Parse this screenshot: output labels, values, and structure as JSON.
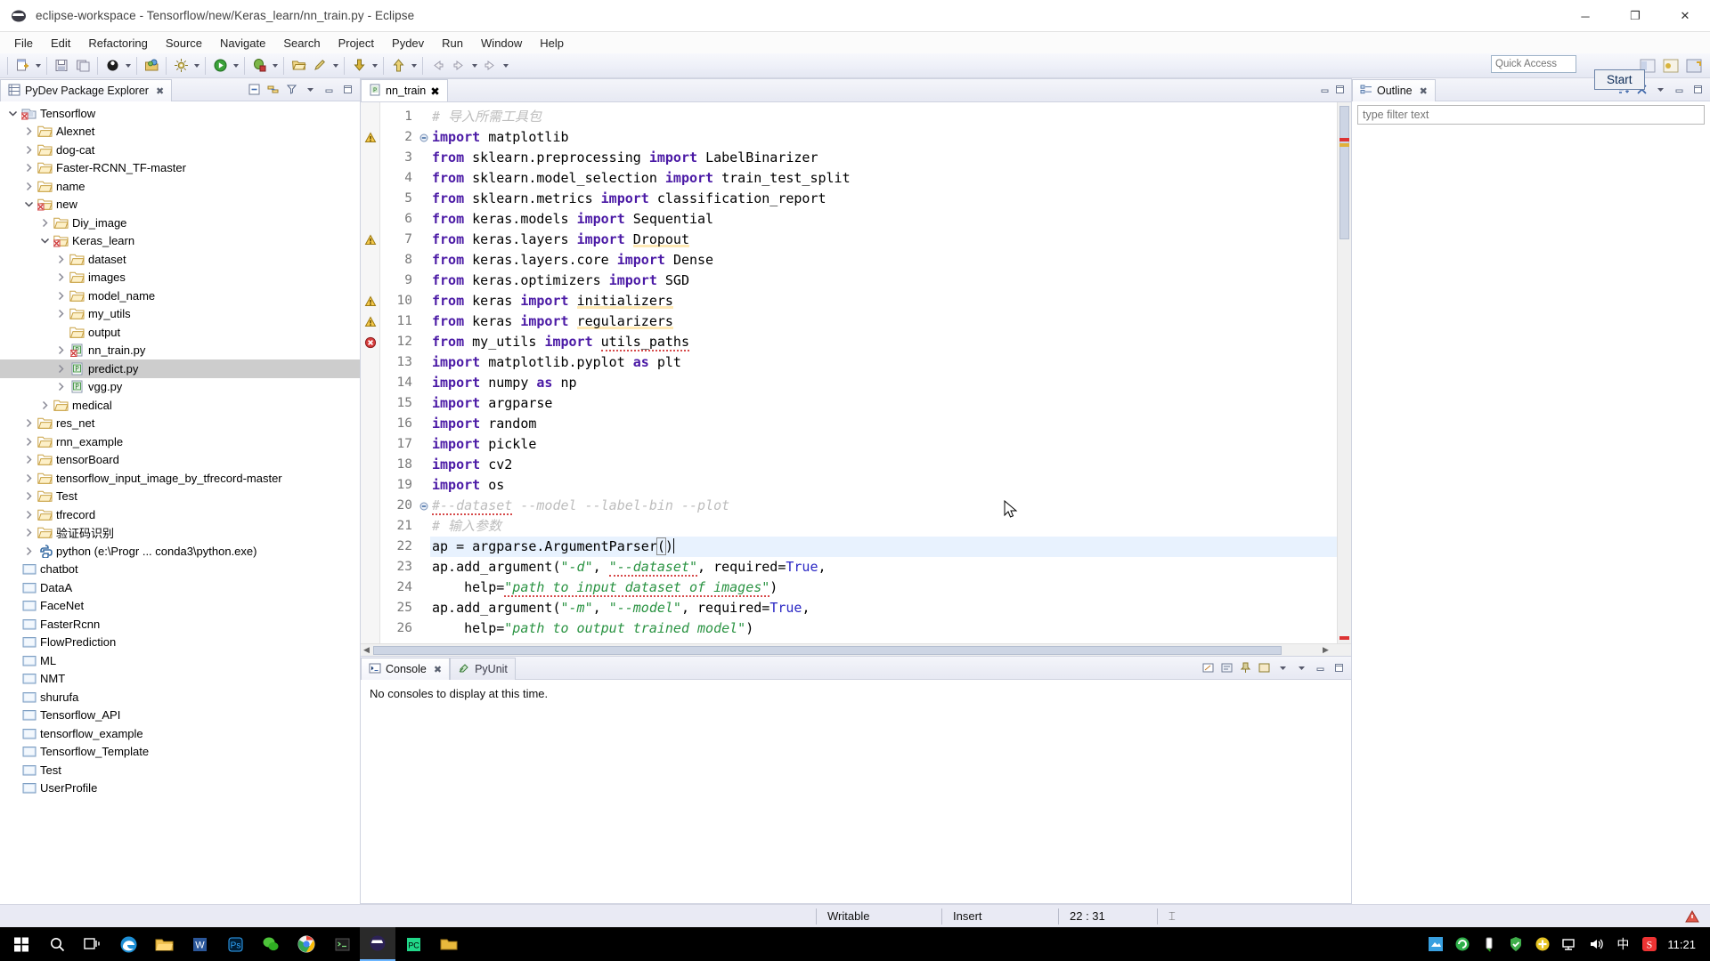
{
  "window": {
    "title": "eclipse-workspace - Tensorflow/new/Keras_learn/nn_train.py - Eclipse",
    "minimize": "─",
    "maximize": "❐",
    "close": "✕"
  },
  "menubar": {
    "items": [
      "File",
      "Edit",
      "Refactoring",
      "Source",
      "Navigate",
      "Search",
      "Project",
      "Pydev",
      "Run",
      "Window",
      "Help"
    ]
  },
  "toolbar": {
    "quick_access_placeholder": "Quick Access",
    "icons": [
      "new-file-icon",
      "save-icon",
      "save-all-icon",
      "debug-perspective-icon",
      "open-type-icon",
      "build-icon",
      "run-icon",
      "debug-icon",
      "open-folder-icon",
      "pencil-icon",
      "download-icon",
      "upload-icon",
      "back-icon",
      "forward-icon",
      "next-annotation-icon"
    ],
    "perspective_icons": [
      "pydev-perspective-icon",
      "java-perspective-icon",
      "open-perspective-icon"
    ]
  },
  "explorer": {
    "tab_title": "PyDev Package Explorer",
    "tab_close": "✖",
    "tools": [
      "collapse-all-icon",
      "link-with-editor-icon",
      "view-filter-icon",
      "view-menu-icon",
      "minimize-icon",
      "maximize-icon"
    ],
    "tree": [
      {
        "label": "Tensorflow",
        "depth": 0,
        "icon": "project-python-icon",
        "twist": "open",
        "selected": false
      },
      {
        "label": "Alexnet",
        "depth": 1,
        "icon": "folder-icon",
        "twist": "closed",
        "selected": false
      },
      {
        "label": "dog-cat",
        "depth": 1,
        "icon": "folder-icon",
        "twist": "closed",
        "selected": false
      },
      {
        "label": "Faster-RCNN_TF-master",
        "depth": 1,
        "icon": "folder-icon",
        "twist": "closed",
        "selected": false
      },
      {
        "label": "name",
        "depth": 1,
        "icon": "folder-icon",
        "twist": "closed",
        "selected": false
      },
      {
        "label": "new",
        "depth": 1,
        "icon": "folder-error-icon",
        "twist": "open",
        "selected": false
      },
      {
        "label": "Diy_image",
        "depth": 2,
        "icon": "folder-icon",
        "twist": "closed",
        "selected": false
      },
      {
        "label": "Keras_learn",
        "depth": 2,
        "icon": "folder-error-icon",
        "twist": "open",
        "selected": false
      },
      {
        "label": "dataset",
        "depth": 3,
        "icon": "folder-icon",
        "twist": "closed",
        "selected": false
      },
      {
        "label": "images",
        "depth": 3,
        "icon": "folder-icon",
        "twist": "closed",
        "selected": false
      },
      {
        "label": "model_name",
        "depth": 3,
        "icon": "folder-icon",
        "twist": "closed",
        "selected": false
      },
      {
        "label": "my_utils",
        "depth": 3,
        "icon": "folder-icon",
        "twist": "closed",
        "selected": false
      },
      {
        "label": "output",
        "depth": 3,
        "icon": "folder-icon",
        "twist": "none",
        "selected": false
      },
      {
        "label": "nn_train.py",
        "depth": 3,
        "icon": "python-error-file-icon",
        "twist": "closed",
        "selected": false
      },
      {
        "label": "predict.py",
        "depth": 3,
        "icon": "python-file-icon",
        "twist": "closed",
        "selected": true
      },
      {
        "label": "vgg.py",
        "depth": 3,
        "icon": "python-file-icon",
        "twist": "closed",
        "selected": false
      },
      {
        "label": "medical",
        "depth": 2,
        "icon": "folder-icon",
        "twist": "closed",
        "selected": false
      },
      {
        "label": "res_net",
        "depth": 1,
        "icon": "folder-icon",
        "twist": "closed",
        "selected": false
      },
      {
        "label": "rnn_example",
        "depth": 1,
        "icon": "folder-icon",
        "twist": "closed",
        "selected": false
      },
      {
        "label": "tensorBoard",
        "depth": 1,
        "icon": "folder-icon",
        "twist": "closed",
        "selected": false
      },
      {
        "label": "tensorflow_input_image_by_tfrecord-master",
        "depth": 1,
        "icon": "folder-icon",
        "twist": "closed",
        "selected": false
      },
      {
        "label": "Test",
        "depth": 1,
        "icon": "folder-icon",
        "twist": "closed",
        "selected": false
      },
      {
        "label": "tfrecord",
        "depth": 1,
        "icon": "folder-icon",
        "twist": "closed",
        "selected": false
      },
      {
        "label": "验证码识别",
        "depth": 1,
        "icon": "folder-icon",
        "twist": "closed",
        "selected": false
      },
      {
        "label": "python  (e:\\Progr ... conda3\\python.exe)",
        "depth": 1,
        "icon": "python-interp-icon",
        "twist": "closed",
        "selected": false
      },
      {
        "label": "chatbot",
        "depth": 0,
        "icon": "closed-project-icon",
        "twist": "none",
        "selected": false
      },
      {
        "label": "DataA",
        "depth": 0,
        "icon": "closed-project-icon",
        "twist": "none",
        "selected": false
      },
      {
        "label": "FaceNet",
        "depth": 0,
        "icon": "closed-project-icon",
        "twist": "none",
        "selected": false
      },
      {
        "label": "FasterRcnn",
        "depth": 0,
        "icon": "closed-project-icon",
        "twist": "none",
        "selected": false
      },
      {
        "label": "FlowPrediction",
        "depth": 0,
        "icon": "closed-project-icon",
        "twist": "none",
        "selected": false
      },
      {
        "label": "ML",
        "depth": 0,
        "icon": "closed-project-icon",
        "twist": "none",
        "selected": false
      },
      {
        "label": "NMT",
        "depth": 0,
        "icon": "closed-project-icon",
        "twist": "none",
        "selected": false
      },
      {
        "label": "shurufa",
        "depth": 0,
        "icon": "closed-project-icon",
        "twist": "none",
        "selected": false
      },
      {
        "label": "Tensorflow_API",
        "depth": 0,
        "icon": "closed-project-icon",
        "twist": "none",
        "selected": false
      },
      {
        "label": "tensorflow_example",
        "depth": 0,
        "icon": "closed-project-icon",
        "twist": "none",
        "selected": false
      },
      {
        "label": "Tensorflow_Template",
        "depth": 0,
        "icon": "closed-project-icon",
        "twist": "none",
        "selected": false
      },
      {
        "label": "Test",
        "depth": 0,
        "icon": "closed-project-icon",
        "twist": "none",
        "selected": false
      },
      {
        "label": "UserProfile",
        "depth": 0,
        "icon": "closed-project-icon",
        "twist": "none",
        "selected": false
      }
    ]
  },
  "editor": {
    "tab_label": "nn_train",
    "tab_icon": "python-file-icon",
    "tab_close": "✖",
    "minimize": "─",
    "maximize": "❐",
    "current_line": 22,
    "lines": [
      {
        "n": 1,
        "ann": "",
        "fold": "",
        "tokens": [
          {
            "t": "# 导入所需工具包",
            "c": "cmt"
          }
        ]
      },
      {
        "n": 2,
        "ann": "warning",
        "fold": "minus",
        "tokens": [
          {
            "t": "import ",
            "c": "kw"
          },
          {
            "t": "matplotlib",
            "c": "plain"
          }
        ]
      },
      {
        "n": 3,
        "ann": "",
        "fold": "",
        "tokens": [
          {
            "t": "from ",
            "c": "kw"
          },
          {
            "t": "sklearn.preprocessing ",
            "c": "plain"
          },
          {
            "t": "import ",
            "c": "kw"
          },
          {
            "t": "LabelBinarizer",
            "c": "plain"
          }
        ]
      },
      {
        "n": 4,
        "ann": "",
        "fold": "",
        "tokens": [
          {
            "t": "from ",
            "c": "kw"
          },
          {
            "t": "sklearn.model_selection ",
            "c": "plain"
          },
          {
            "t": "import ",
            "c": "kw"
          },
          {
            "t": "train_test_split",
            "c": "plain"
          }
        ]
      },
      {
        "n": 5,
        "ann": "",
        "fold": "",
        "tokens": [
          {
            "t": "from ",
            "c": "kw"
          },
          {
            "t": "sklearn.metrics ",
            "c": "plain"
          },
          {
            "t": "import ",
            "c": "kw"
          },
          {
            "t": "classification_report",
            "c": "plain"
          }
        ]
      },
      {
        "n": 6,
        "ann": "",
        "fold": "",
        "tokens": [
          {
            "t": "from ",
            "c": "kw"
          },
          {
            "t": "keras.models ",
            "c": "plain"
          },
          {
            "t": "import ",
            "c": "kw"
          },
          {
            "t": "Sequential",
            "c": "plain"
          }
        ]
      },
      {
        "n": 7,
        "ann": "warning",
        "fold": "",
        "tokens": [
          {
            "t": "from ",
            "c": "kw"
          },
          {
            "t": "keras.layers ",
            "c": "plain"
          },
          {
            "t": "import ",
            "c": "kw"
          },
          {
            "t": "Dropout",
            "c": "plain sqy"
          }
        ]
      },
      {
        "n": 8,
        "ann": "",
        "fold": "",
        "tokens": [
          {
            "t": "from ",
            "c": "kw"
          },
          {
            "t": "keras.layers.core ",
            "c": "plain"
          },
          {
            "t": "import ",
            "c": "kw"
          },
          {
            "t": "Dense",
            "c": "plain"
          }
        ]
      },
      {
        "n": 9,
        "ann": "",
        "fold": "",
        "tokens": [
          {
            "t": "from ",
            "c": "kw"
          },
          {
            "t": "keras.optimizers ",
            "c": "plain"
          },
          {
            "t": "import ",
            "c": "kw"
          },
          {
            "t": "SGD",
            "c": "plain"
          }
        ]
      },
      {
        "n": 10,
        "ann": "warning",
        "fold": "",
        "tokens": [
          {
            "t": "from ",
            "c": "kw"
          },
          {
            "t": "keras ",
            "c": "plain"
          },
          {
            "t": "import ",
            "c": "kw"
          },
          {
            "t": "initializers",
            "c": "plain sqy"
          }
        ]
      },
      {
        "n": 11,
        "ann": "warning",
        "fold": "",
        "tokens": [
          {
            "t": "from ",
            "c": "kw"
          },
          {
            "t": "keras ",
            "c": "plain"
          },
          {
            "t": "import ",
            "c": "kw"
          },
          {
            "t": "regularizers",
            "c": "plain sqy"
          }
        ]
      },
      {
        "n": 12,
        "ann": "error",
        "fold": "",
        "tokens": [
          {
            "t": "from ",
            "c": "kw"
          },
          {
            "t": "my_utils ",
            "c": "plain"
          },
          {
            "t": "import ",
            "c": "kw"
          },
          {
            "t": "utils_paths",
            "c": "plain sq"
          }
        ]
      },
      {
        "n": 13,
        "ann": "",
        "fold": "",
        "tokens": [
          {
            "t": "import ",
            "c": "kw"
          },
          {
            "t": "matplotlib.pyplot ",
            "c": "plain"
          },
          {
            "t": "as ",
            "c": "kw"
          },
          {
            "t": "plt",
            "c": "plain"
          }
        ]
      },
      {
        "n": 14,
        "ann": "",
        "fold": "",
        "tokens": [
          {
            "t": "import ",
            "c": "kw"
          },
          {
            "t": "numpy ",
            "c": "plain"
          },
          {
            "t": "as ",
            "c": "kw"
          },
          {
            "t": "np",
            "c": "plain"
          }
        ]
      },
      {
        "n": 15,
        "ann": "",
        "fold": "",
        "tokens": [
          {
            "t": "import ",
            "c": "kw"
          },
          {
            "t": "argparse",
            "c": "plain"
          }
        ]
      },
      {
        "n": 16,
        "ann": "",
        "fold": "",
        "tokens": [
          {
            "t": "import ",
            "c": "kw"
          },
          {
            "t": "random",
            "c": "plain"
          }
        ]
      },
      {
        "n": 17,
        "ann": "",
        "fold": "",
        "tokens": [
          {
            "t": "import ",
            "c": "kw"
          },
          {
            "t": "pickle",
            "c": "plain"
          }
        ]
      },
      {
        "n": 18,
        "ann": "",
        "fold": "",
        "tokens": [
          {
            "t": "import ",
            "c": "kw"
          },
          {
            "t": "cv2",
            "c": "plain"
          }
        ]
      },
      {
        "n": 19,
        "ann": "",
        "fold": "",
        "tokens": [
          {
            "t": "import ",
            "c": "kw"
          },
          {
            "t": "os",
            "c": "plain"
          }
        ]
      },
      {
        "n": 20,
        "ann": "",
        "fold": "minus",
        "tokens": [
          {
            "t": "#--dataset",
            "c": "cmt sq"
          },
          {
            "t": " --model --label-bin --plot",
            "c": "cmt"
          }
        ]
      },
      {
        "n": 21,
        "ann": "",
        "fold": "",
        "tokens": [
          {
            "t": "# 输入参数",
            "c": "cmt"
          }
        ]
      },
      {
        "n": 22,
        "ann": "",
        "fold": "",
        "tokens": [
          {
            "t": "ap = argparse.ArgumentParser",
            "c": "plain"
          },
          {
            "t": "(",
            "c": "plain brkt"
          },
          {
            "t": ")",
            "c": "plain"
          }
        ]
      },
      {
        "n": 23,
        "ann": "",
        "fold": "",
        "tokens": [
          {
            "t": "ap.add_argument(",
            "c": "plain"
          },
          {
            "t": "\"-d\"",
            "c": "str"
          },
          {
            "t": ", ",
            "c": "plain"
          },
          {
            "t": "\"--dataset\"",
            "c": "str sq"
          },
          {
            "t": ", required=",
            "c": "plain"
          },
          {
            "t": "True",
            "c": "builtin"
          },
          {
            "t": ",",
            "c": "plain"
          }
        ]
      },
      {
        "n": 24,
        "ann": "",
        "fold": "",
        "tokens": [
          {
            "t": "    help=",
            "c": "plain"
          },
          {
            "t": "\"path to input dataset of images\"",
            "c": "str sq"
          },
          {
            "t": ")",
            "c": "plain"
          }
        ]
      },
      {
        "n": 25,
        "ann": "",
        "fold": "",
        "tokens": [
          {
            "t": "ap.add_argument(",
            "c": "plain"
          },
          {
            "t": "\"-m\"",
            "c": "str"
          },
          {
            "t": ", ",
            "c": "plain"
          },
          {
            "t": "\"--model\"",
            "c": "str"
          },
          {
            "t": ", required=",
            "c": "plain"
          },
          {
            "t": "True",
            "c": "builtin"
          },
          {
            "t": ",",
            "c": "plain"
          }
        ]
      },
      {
        "n": 26,
        "ann": "",
        "fold": "",
        "tokens": [
          {
            "t": "    help=",
            "c": "plain"
          },
          {
            "t": "\"path to output trained model\"",
            "c": "str"
          },
          {
            "t": ")",
            "c": "plain"
          }
        ]
      }
    ]
  },
  "console": {
    "tabs": [
      {
        "label": "Console",
        "icon": "console-icon",
        "active": true,
        "close": "✖"
      },
      {
        "label": "PyUnit",
        "icon": "pyunit-icon",
        "active": false,
        "close": ""
      }
    ],
    "message": "No consoles to display at this time.",
    "tools": [
      "clear-console-icon",
      "scroll-lock-icon",
      "pin-console-icon",
      "open-console-icon",
      "view-menu-icon",
      "minimize-icon",
      "maximize-icon"
    ]
  },
  "outline": {
    "tab_title": "Outline",
    "tab_close": "✖",
    "filter_placeholder": "type filter text",
    "tools": [
      "sort-icon",
      "hide-fields-icon",
      "view-menu-icon",
      "minimize-icon",
      "maximize-icon"
    ]
  },
  "start_button": {
    "label": "Start"
  },
  "statusbar": {
    "writable": "Writable",
    "insert": "Insert",
    "position": "22 : 31",
    "extra": "⌶"
  },
  "taskbar": {
    "items": [
      "windows-start-icon",
      "search-icon",
      "task-view-icon",
      "edge-icon",
      "file-explorer-icon",
      "word-icon",
      "photoshop-icon",
      "wechat-icon",
      "chrome-icon",
      "terminal-icon",
      "eclipse-icon",
      "pycharm-icon",
      "folder-icon"
    ],
    "tray": [
      "screenshot-icon",
      "360-icon",
      "usb-icon",
      "shield-icon",
      "update-icon",
      "network-icon",
      "volume-icon"
    ],
    "ime": "中",
    "sogou": "S",
    "clock": "11:21"
  },
  "colors": {
    "keyword": "#4a19a5",
    "string": "#2a9342",
    "comment": "#bdbdbd",
    "builtin": "#2a27c4",
    "selection": "#cdcdcd",
    "current_line": "#e8f2fe",
    "error": "#d64a4a",
    "accent": "#6cb6ff"
  }
}
